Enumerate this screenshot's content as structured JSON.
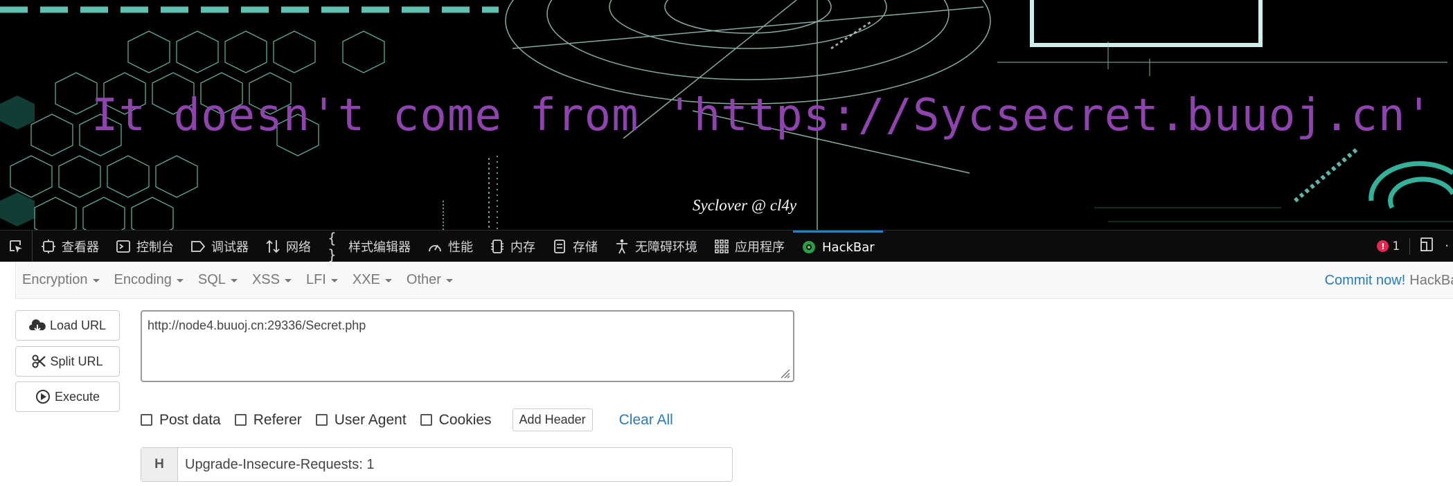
{
  "page": {
    "banner_text": "It doesn't come from 'https://Sycsecret.buuoj.cn'",
    "signature": "Syclover @ cl4y"
  },
  "devtools": {
    "tabs": [
      {
        "label": "查看器",
        "icon": "inspector-icon"
      },
      {
        "label": "控制台",
        "icon": "console-icon"
      },
      {
        "label": "调试器",
        "icon": "debugger-icon"
      },
      {
        "label": "网络",
        "icon": "network-icon"
      },
      {
        "label": "样式编辑器",
        "icon": "style-editor-icon"
      },
      {
        "label": "性能",
        "icon": "performance-icon"
      },
      {
        "label": "内存",
        "icon": "memory-icon"
      },
      {
        "label": "存储",
        "icon": "storage-icon"
      },
      {
        "label": "无障碍环境",
        "icon": "accessibility-icon"
      },
      {
        "label": "应用程序",
        "icon": "application-icon"
      },
      {
        "label": "HackBar",
        "icon": "hackbar-icon"
      }
    ],
    "active_tab": "HackBar",
    "error_count": "1",
    "accent_color": "#0a84ff",
    "error_color": "#e22850"
  },
  "hackbar": {
    "menu": [
      {
        "label": "Encryption"
      },
      {
        "label": "Encoding"
      },
      {
        "label": "SQL"
      },
      {
        "label": "XSS"
      },
      {
        "label": "LFI"
      },
      {
        "label": "XXE"
      },
      {
        "label": "Other"
      }
    ],
    "commit_link": "Commit now!",
    "brand": "HackBar",
    "buttons": {
      "load_url": "Load URL",
      "split_url": "Split URL",
      "execute": "Execute"
    },
    "url_value": "http://node4.buuoj.cn:29336/Secret.php",
    "options": {
      "post_data": "Post data",
      "referer": "Referer",
      "user_agent": "User Agent",
      "cookies": "Cookies"
    },
    "add_header": "Add Header",
    "clear_all": "Clear All",
    "header_prefix": "H",
    "header_value": "Upgrade-Insecure-Requests: 1"
  }
}
